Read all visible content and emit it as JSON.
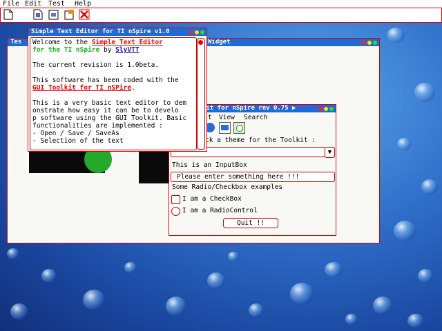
{
  "menu": [
    "File",
    "Edit",
    "Test",
    "Help"
  ],
  "toolbar": {
    "icons": [
      "new-file-icon",
      "open-file-icon",
      "save-file-icon",
      "close-icon"
    ]
  },
  "back_window": {
    "title_left": "Tes",
    "title_right": "Widget"
  },
  "editor": {
    "title": "Simple Text Editor for TI nSpire v1.0",
    "line1a": "Welcome to the",
    "line1b": "Simple Text Editor",
    "line2a": "for the TI nSpire",
    "line2b": "by",
    "line2c": "SlyVTT",
    "line3": "The current revision is 1.0beta.",
    "line4": "This software has been coded with the",
    "line5": "GUI Toolkit for TI nSPire",
    "line5end": ".",
    "line6": "This is a very basic text editor to dem",
    "line7": "onstrate how easy it can be to develo",
    "line8": "p software using the GUI Toolkit. Basic",
    "line9": " functionalities are implemented :",
    "line10": "   - Open / Save / SaveAs",
    "line11": "   - Selection of the text"
  },
  "toolkit": {
    "title": "kit for nSpire rev 0.75",
    "menu": [
      "t",
      "View",
      "Search"
    ],
    "theme_label": "ck a theme for the Toolkit :",
    "inputbox_label": "This is an InputBox",
    "input_placeholder": "Please enter something here !!!",
    "radio_label": "Some Radio/Checkbox examples",
    "checkbox_label": "I am a CheckBox",
    "radio_control_label": "I am a RadioControl",
    "quit_label": "Quit !!"
  },
  "colors": {
    "accent_red": "#dd0000",
    "title_blue": "#1e6ad6",
    "link_green": "#17b017"
  }
}
